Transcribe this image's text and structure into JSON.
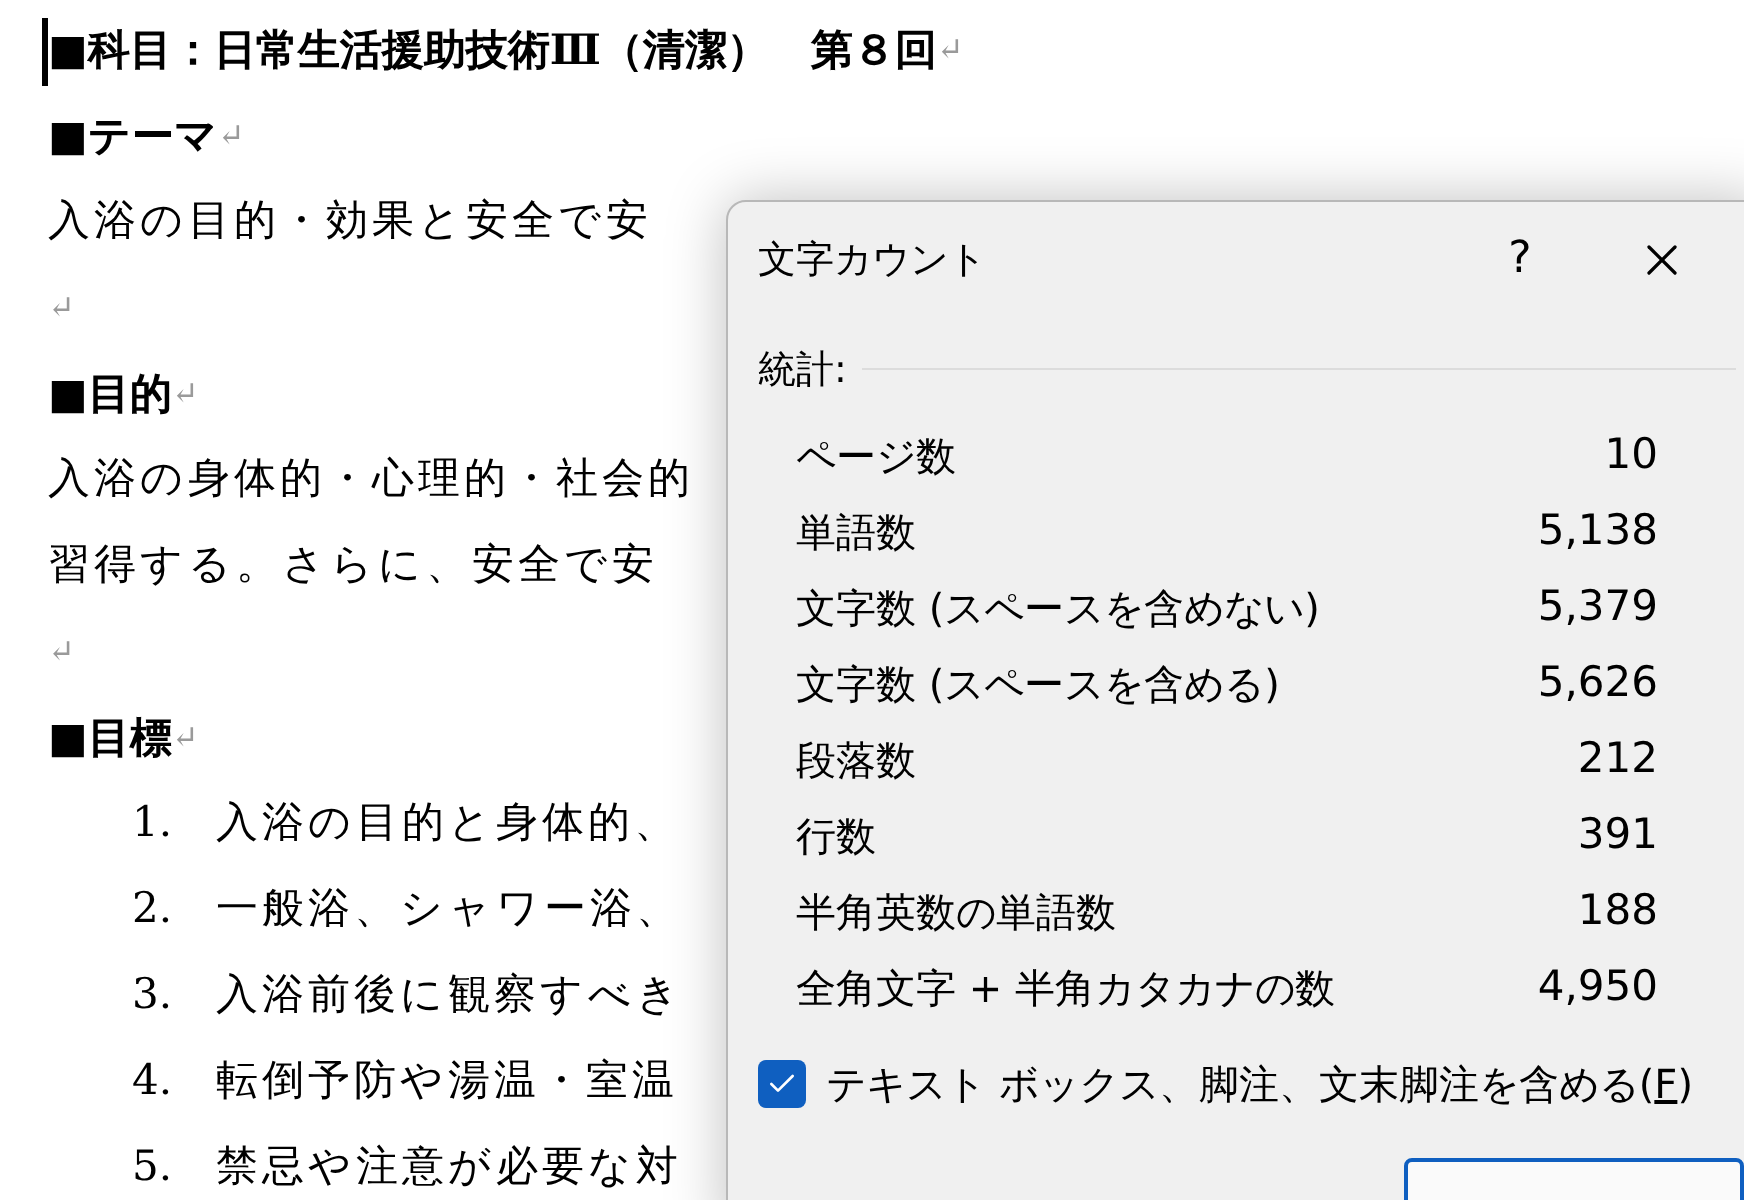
{
  "document": {
    "paragraphs": [
      {
        "kind": "title",
        "text": "■科目：日常生活援助技術Ⅲ（清潔）　第８回",
        "mark": "↵"
      },
      {
        "kind": "heading",
        "text": "■テーマ",
        "mark": "↵"
      },
      {
        "kind": "body",
        "text": "入浴の目的・効果と安全で安"
      },
      {
        "kind": "empty",
        "mark": "↵"
      },
      {
        "kind": "heading",
        "text": "■目的",
        "mark": "↵"
      },
      {
        "kind": "body",
        "text": "入浴の身体的・心理的・社会的"
      },
      {
        "kind": "body",
        "text": "習得する。さらに、安全で安"
      },
      {
        "kind": "empty",
        "mark": "↵"
      },
      {
        "kind": "heading",
        "text": "■目標",
        "mark": "↵"
      },
      {
        "kind": "item",
        "number": "1.",
        "text": "入浴の目的と身体的、"
      },
      {
        "kind": "item",
        "number": "2.",
        "text": "一般浴、シャワー浴、"
      },
      {
        "kind": "item",
        "number": "3.",
        "text": "入浴前後に観察すべき"
      },
      {
        "kind": "item",
        "number": "4.",
        "text": "転倒予防や湯温・室温"
      },
      {
        "kind": "item",
        "number": "5.",
        "text": "禁忌や注意が必要な対"
      }
    ]
  },
  "dialog": {
    "title": "文字カウント",
    "help": "?",
    "section": "統計:",
    "stats": [
      {
        "label": "ページ数",
        "value": "10"
      },
      {
        "label": "単語数",
        "value": "5,138"
      },
      {
        "label": "文字数 (スペースを含めない)",
        "value": "5,379"
      },
      {
        "label": "文字数 (スペースを含める)",
        "value": "5,626"
      },
      {
        "label": "段落数",
        "value": "212"
      },
      {
        "label": "行数",
        "value": "391"
      },
      {
        "label": "半角英数の単語数",
        "value": "188"
      },
      {
        "label": "全角文字 + 半角カタカナの数",
        "value": "4,950"
      }
    ],
    "checkbox": {
      "label": "テキスト ボックス、脚注、文末脚注を含める(",
      "key": "F",
      "end": ")",
      "checked": true
    }
  }
}
